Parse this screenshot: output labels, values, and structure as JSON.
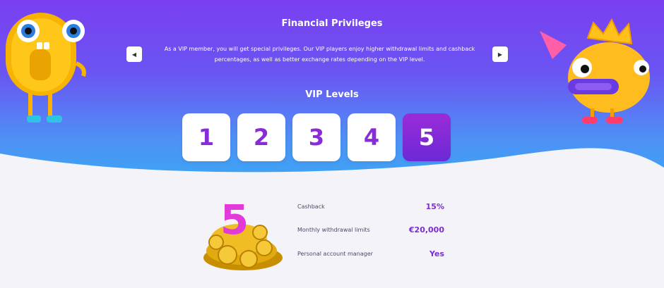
{
  "privileges": {
    "title": "Financial Privileges",
    "description": "As a VIP member, you will get special privileges. Our VIP players enjoy higher withdrawal limits and cashback percentages, as well as better exchange rates depending on the VIP level.",
    "prev_icon": "triangle-left",
    "next_icon": "triangle-right"
  },
  "vip": {
    "title": "VIP Levels",
    "levels": [
      "1",
      "2",
      "3",
      "4",
      "5"
    ],
    "active_level": "5"
  },
  "details": {
    "badge_number": "5",
    "rows": [
      {
        "label": "Cashback",
        "value": "15%"
      },
      {
        "label": "Monthly withdrawal limits",
        "value": "€20,000"
      },
      {
        "label": "Personal account manager",
        "value": "Yes"
      }
    ]
  },
  "colors": {
    "accent": "#7b2dd6",
    "hero_top": "#7a3ff0",
    "hero_bottom": "#3aa7f4"
  }
}
